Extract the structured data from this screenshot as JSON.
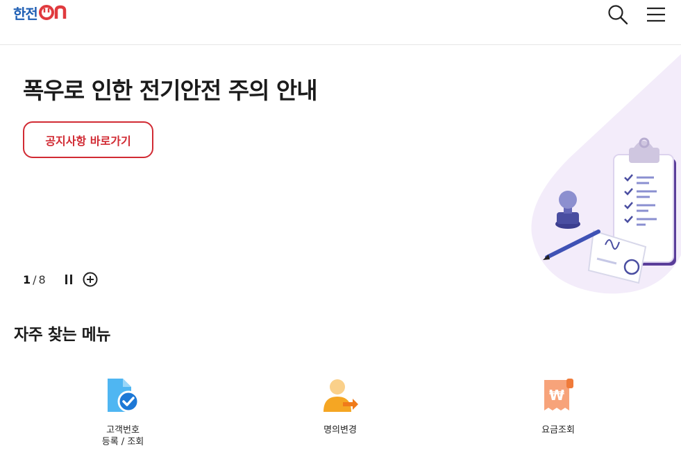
{
  "header": {
    "logo_text": "한전",
    "logo_suffix": "ON",
    "search_icon": "search-icon",
    "menu_icon": "hamburger-menu-icon"
  },
  "hero": {
    "title": "폭우로 인한 전기안전 주의 안내",
    "button_label": "공지사항 바로가기",
    "illustration": "clipboard-stamp-document-illustration",
    "pager_current": "1",
    "pager_sep": "/",
    "pager_total": "8",
    "pause_icon": "pause-icon",
    "plus_icon": "plus-circle-icon"
  },
  "quick_menu": {
    "title": "자주 찾는 메뉴",
    "items": [
      {
        "line1": "고객번호",
        "line2": "등록 / 조회",
        "icon": "document-check-icon"
      },
      {
        "line1": "명의변경",
        "line2": "",
        "icon": "user-transfer-icon"
      },
      {
        "line1": "요금조회",
        "line2": "",
        "icon": "won-receipt-icon"
      }
    ]
  },
  "colors": {
    "brand_blue": "#1f5fb4",
    "brand_red": "#d12a33",
    "hero_bg": "#f3ecfa",
    "icon_blue": "#4fb6f2",
    "icon_orange": "#f5a623",
    "icon_salmon": "#f7a37a"
  }
}
